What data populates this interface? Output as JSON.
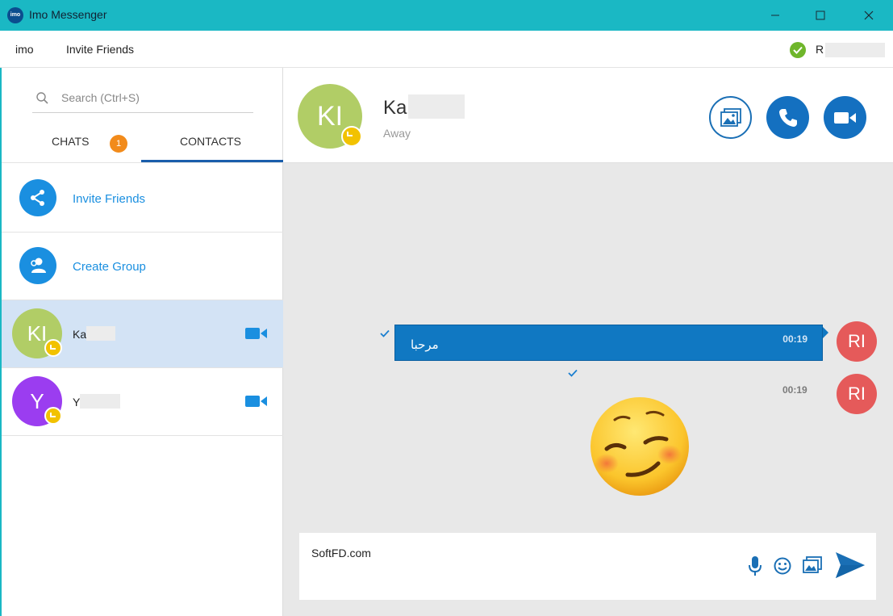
{
  "window": {
    "title": "Imo Messenger",
    "app_icon_label": "imo",
    "titlebar_color": "#1ab8c4"
  },
  "menu": {
    "items": [
      "imo",
      "Invite Friends"
    ],
    "user_initial": "R"
  },
  "sidebar": {
    "search_placeholder": "Search (Ctrl+S)",
    "tabs": [
      {
        "label": "CHATS",
        "badge": "1"
      },
      {
        "label": "CONTACTS",
        "active": true
      }
    ],
    "actions": [
      {
        "label": "Invite Friends",
        "icon": "share-icon"
      },
      {
        "label": "Create Group",
        "icon": "group-icon"
      }
    ],
    "contacts": [
      {
        "initials": "KI",
        "name": "Ka",
        "avatar_color": "#b1cd66",
        "status": "away",
        "selected": true
      },
      {
        "initials": "Y",
        "name": "Y",
        "avatar_color": "#9b3df0",
        "status": "away",
        "selected": false
      }
    ]
  },
  "chat": {
    "contact_initials": "KI",
    "contact_name": "Ka",
    "contact_status": "Away",
    "messages": [
      {
        "text": "مرحبا",
        "time": "00:19",
        "sender_initials": "RI"
      },
      {
        "text": "",
        "time": "00:19",
        "sender_initials": "RI",
        "sticker": "blushing-smile-emoji"
      }
    ],
    "composer_text": "SoftFD.com"
  },
  "colors": {
    "accent_blue": "#1a8fe0",
    "bubble_blue": "#1078c2",
    "self_avatar": "#e55a5a",
    "away": "#f2c200",
    "online": "#6fb62b"
  }
}
